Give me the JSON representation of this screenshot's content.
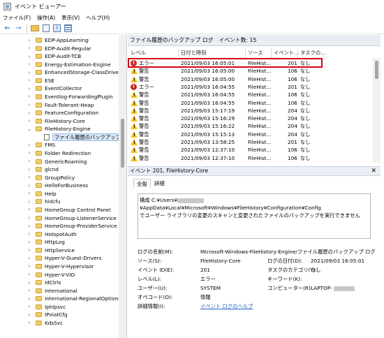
{
  "window": {
    "title": "イベント ビューアー"
  },
  "menu": [
    {
      "label": "ファイル(F)"
    },
    {
      "label": "操作(A)"
    },
    {
      "label": "表示(V)"
    },
    {
      "label": "ヘルプ(H)"
    }
  ],
  "toolbar": {
    "back_icon": "back-arrow-icon",
    "forward_icon": "forward-arrow-icon"
  },
  "tree": [
    {
      "label": "EDP-AppLearning"
    },
    {
      "label": "EDP-Audit-Regular"
    },
    {
      "label": "EDP-Audit-TCB"
    },
    {
      "label": "Energy-Estimation-Engine"
    },
    {
      "label": "EnhancedStorage-ClassDriver"
    },
    {
      "label": "ESE"
    },
    {
      "label": "EventCollector"
    },
    {
      "label": "Eventlog-ForwardingPlugin"
    },
    {
      "label": "Fault-Tolerant-Heap"
    },
    {
      "label": "FeatureConfiguration"
    },
    {
      "label": "FileHistory-Core"
    },
    {
      "label": "FileHistory-Engine",
      "expanded": true
    },
    {
      "label": "ファイル履歴のバックアップ ログ",
      "child": true,
      "selected": true
    },
    {
      "label": "FMS"
    },
    {
      "label": "Folder Redirection"
    },
    {
      "label": "GenericRoaming"
    },
    {
      "label": "glcnd"
    },
    {
      "label": "GroupPolicy"
    },
    {
      "label": "HelloForBusiness"
    },
    {
      "label": "Help"
    },
    {
      "label": "hidcfu"
    },
    {
      "label": "HomeGroup Control Panel"
    },
    {
      "label": "HomeGroup-ListenerService"
    },
    {
      "label": "HomeGroup-ProviderService"
    },
    {
      "label": "HotspotAuth"
    },
    {
      "label": "HttpLog"
    },
    {
      "label": "HttpService"
    },
    {
      "label": "Hyper-V-Guest-Drivers"
    },
    {
      "label": "Hyper-V-Hypervisor"
    },
    {
      "label": "Hyper-V-VID"
    },
    {
      "label": "IdCtrls"
    },
    {
      "label": "International"
    },
    {
      "label": "International-RegionalOptionsC"
    },
    {
      "label": "Iphlpsvc"
    },
    {
      "label": "IPxlatCfg"
    },
    {
      "label": "KdsSvc"
    }
  ],
  "log_list": {
    "title": "ファイル履歴のバックアップ ログ",
    "count": "イベント数: 15",
    "columns": [
      "レベル",
      "日付と時刻",
      "ソース",
      "イベント...",
      "タスクの..."
    ],
    "rows": [
      {
        "level": "エラー",
        "type": "error",
        "datetime": "2021/09/03 16:05:01",
        "source": "FileHist...",
        "id": "201",
        "task": "なし"
      },
      {
        "level": "警告",
        "type": "warning",
        "datetime": "2021/09/03 16:05:00",
        "source": "FileHist...",
        "id": "106",
        "task": "なし"
      },
      {
        "level": "警告",
        "type": "warning",
        "datetime": "2021/09/03 16:05:00",
        "source": "FileHist...",
        "id": "106",
        "task": "なし"
      },
      {
        "level": "エラー",
        "type": "error",
        "datetime": "2021/09/03 16:04:55",
        "source": "FileHist...",
        "id": "201",
        "task": "なし"
      },
      {
        "level": "警告",
        "type": "warning",
        "datetime": "2021/09/03 16:04:55",
        "source": "FileHist...",
        "id": "106",
        "task": "なし"
      },
      {
        "level": "警告",
        "type": "warning",
        "datetime": "2021/09/03 16:04:55",
        "source": "FileHist...",
        "id": "106",
        "task": "なし"
      },
      {
        "level": "警告",
        "type": "warning",
        "datetime": "2021/09/03 15:17:19",
        "source": "FileHist...",
        "id": "204",
        "task": "なし"
      },
      {
        "level": "警告",
        "type": "warning",
        "datetime": "2021/09/03 15:16:29",
        "source": "FileHist...",
        "id": "204",
        "task": "なし"
      },
      {
        "level": "警告",
        "type": "warning",
        "datetime": "2021/09/03 15:16:22",
        "source": "FileHist...",
        "id": "204",
        "task": "なし"
      },
      {
        "level": "警告",
        "type": "warning",
        "datetime": "2021/09/03 15:15:13",
        "source": "FileHist...",
        "id": "204",
        "task": "なし"
      },
      {
        "level": "警告",
        "type": "warning",
        "datetime": "2021/09/03 13:58:25",
        "source": "FileHist...",
        "id": "201",
        "task": "なし"
      },
      {
        "level": "警告",
        "type": "warning",
        "datetime": "2021/09/03 12:37:10",
        "source": "FileHist...",
        "id": "106",
        "task": "なし"
      },
      {
        "level": "警告",
        "type": "warning",
        "datetime": "2021/09/03 12:37:10",
        "source": "FileHist...",
        "id": "106",
        "task": "なし"
      }
    ]
  },
  "detail": {
    "title": "イベント 201, FileHistory-Core",
    "tabs": [
      "全般",
      "詳細"
    ],
    "description_prefix": "構成 C:¥Users¥",
    "description_suffix": "¥AppData¥Local¥Microsoft¥Windows¥FileHistory¥Configuration¥Config",
    "description_line2": "でユーザー ライブラリの変更のスキャンと変更されたファイルのバックアップを実行できません",
    "labels": {
      "log_name": "ログの名前(M):",
      "source": "ソース(S):",
      "event_id": "イベント ID(E):",
      "level": "レベル(L):",
      "user": "ユーザー(U):",
      "opcode": "オペコード(O):",
      "more_info": "詳細情報(I):",
      "logged": "ログの日付(D):",
      "task_category": "タスクのカテゴリ(Y):",
      "keywords": "キーワード(K):",
      "computer": "コンピューター(R):"
    },
    "values": {
      "log_name": "Microsoft-Windows-FileHistory-Engine/ファイル履歴のバックアップ ログ",
      "source": "FileHistory-Core",
      "event_id": "201",
      "level": "エラー",
      "user": "SYSTEM",
      "opcode": "情報",
      "more_info_link": "イベント ログのヘルプ",
      "logged": "2021/09/03 16:05:01",
      "task_category": "なし",
      "keywords": "",
      "computer_prefix": "LAPTOP-"
    }
  }
}
